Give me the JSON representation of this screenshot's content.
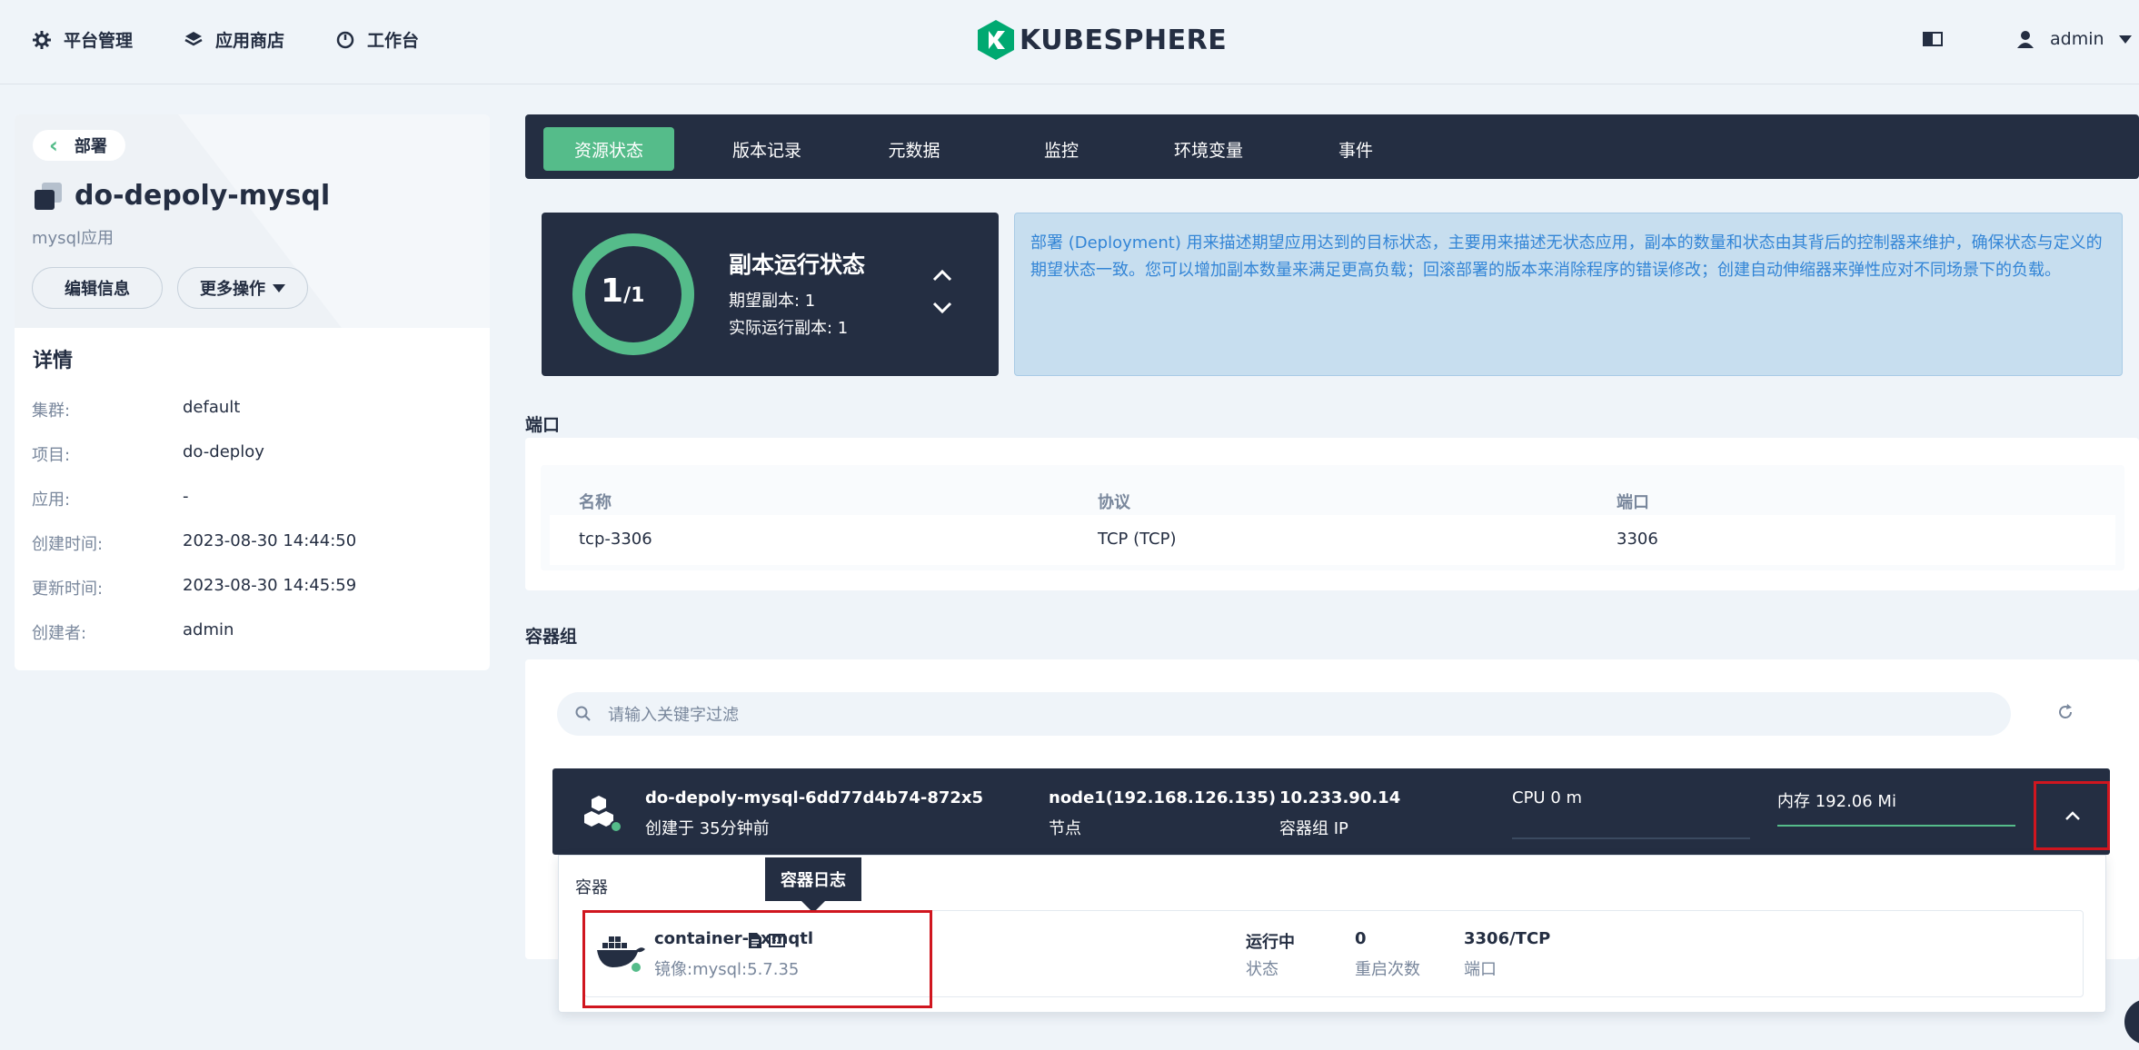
{
  "topnav": {
    "platform": "平台管理",
    "appstore": "应用商店",
    "workbench": "工作台",
    "logo_text": "KUBESPHERE",
    "user": "admin"
  },
  "left": {
    "back_label": "部署",
    "title": "do-depoly-mysql",
    "subtitle": "mysql应用",
    "edit_label": "编辑信息",
    "more_label": "更多操作",
    "details_heading": "详情",
    "details": [
      {
        "key": "集群:",
        "value": "default"
      },
      {
        "key": "项目:",
        "value": "do-deploy"
      },
      {
        "key": "应用:",
        "value": "-"
      },
      {
        "key": "创建时间:",
        "value": "2023-08-30 14:44:50"
      },
      {
        "key": "更新时间:",
        "value": "2023-08-30 14:45:59"
      },
      {
        "key": "创建者:",
        "value": "admin"
      }
    ]
  },
  "tabs": [
    "资源状态",
    "版本记录",
    "元数据",
    "监控",
    "环境变量",
    "事件"
  ],
  "status": {
    "ready": "1",
    "total": "/1",
    "ready_fraction": 1.0,
    "title": "副本运行状态",
    "desired": "期望副本: 1",
    "running": "实际运行副本: 1"
  },
  "description": "部署 (Deployment) 用来描述期望应用达到的目标状态，主要用来描述无状态应用，副本的数量和状态由其背后的控制器来维护，确保状态与定义的期望状态一致。您可以增加副本数量来满足更高负载；回滚部署的版本来消除程序的错误修改；创建自动伸缩器来弹性应对不同场景下的负载。",
  "ports": {
    "heading": "端口",
    "columns": [
      "名称",
      "协议",
      "端口"
    ],
    "rows": [
      [
        "tcp-3306",
        "TCP (TCP)",
        "3306"
      ]
    ]
  },
  "podgroup": {
    "heading": "容器组",
    "search_placeholder": "请输入关键字过滤",
    "pod": {
      "name": "do-depoly-mysql-6dd77d4b74-872x5",
      "created": "创建于 35分钟前",
      "node": "node1(192.168.126.135)",
      "node_label": "节点",
      "ip": "10.233.90.14",
      "ip_label": "容器组 IP",
      "cpu": "CPU 0 m",
      "memory": "内存 192.06 Mi",
      "memory_fraction": 1.0
    }
  },
  "container": {
    "section_label": "容器",
    "tooltip": "容器日志",
    "name": "container-gxmqtl",
    "image": "镜像:mysql:5.7.35",
    "status": "运行中",
    "status_label": "状态",
    "restarts": "0",
    "restarts_label": "重启次数",
    "port": "3306/TCP",
    "port_label": "端口"
  },
  "colors": {
    "accent": "#55bc8a",
    "dark": "#242e42",
    "highlight": "#d0161f",
    "info": "#3385d6"
  }
}
